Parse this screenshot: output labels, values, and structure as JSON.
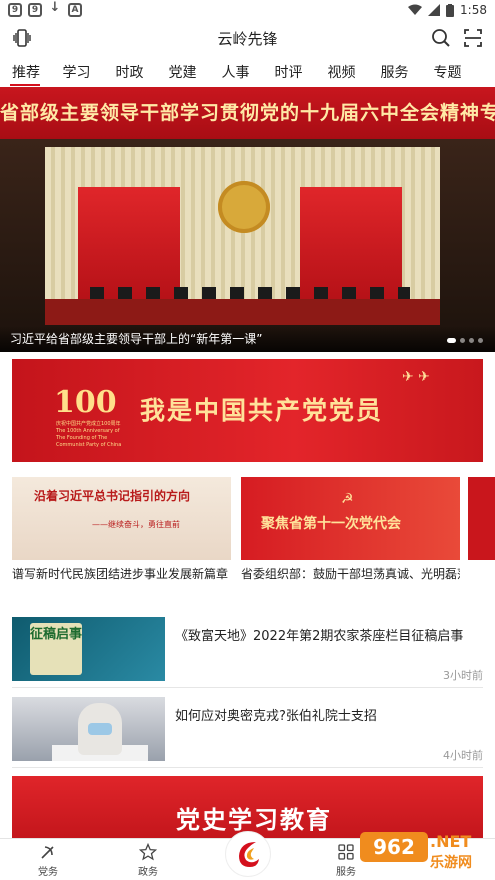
{
  "statusbar": {
    "time": "1:58",
    "left_icons": [
      "9",
      "9",
      "↓",
      "A"
    ]
  },
  "appbar": {
    "title": "云岭先锋"
  },
  "tabs": [
    "推荐",
    "学习",
    "时政",
    "党建",
    "人事",
    "时评",
    "视频",
    "服务",
    "专题"
  ],
  "hero": {
    "banner_text": "省部级主要领导干部学习贯彻党的十九届六中全会精神专题研讨班",
    "caption": "习近平给省部级主要领导干部上的“新年第一课”",
    "slide_count": 4
  },
  "banner100": {
    "logo": "100",
    "logo_sub": "庆祝中国共产党成立100周年 The 100th Anniversary of The Founding of The Communist Party of China",
    "text": "我是中国共产党党员"
  },
  "cards": [
    {
      "img_line1": "沿着习近平总书记指引的方向",
      "img_line2": "——继续奋斗，勇往直前",
      "caption": "谱写新时代民族团结进步事业发展新篇章"
    },
    {
      "img_line1": "聚焦省第十一次党代会",
      "caption": "省委组织部：鼓励干部坦荡真诚、光明磊落"
    }
  ],
  "news": [
    {
      "thumb_text": "征稿启事",
      "title": "《致富天地》2022年第2期农家茶座栏目征稿启事",
      "time": "3小时前"
    },
    {
      "title": "如何应对奥密克戎?张伯礼院士支招",
      "time": "4小时前"
    }
  ],
  "big_banner": {
    "text": "党史学习教育"
  },
  "bottom_nav": [
    {
      "label": "党务",
      "icon": "party-emblem-icon"
    },
    {
      "label": "政务",
      "icon": "star-icon"
    },
    {
      "label": "服务",
      "icon": "grid-icon"
    }
  ],
  "watermark": {
    "badge": "962",
    "net": ".NET",
    "site": "乐游网"
  },
  "colors": {
    "accent": "#d4101d",
    "banner_red": "#c8161e",
    "gold": "#ffe29a"
  }
}
